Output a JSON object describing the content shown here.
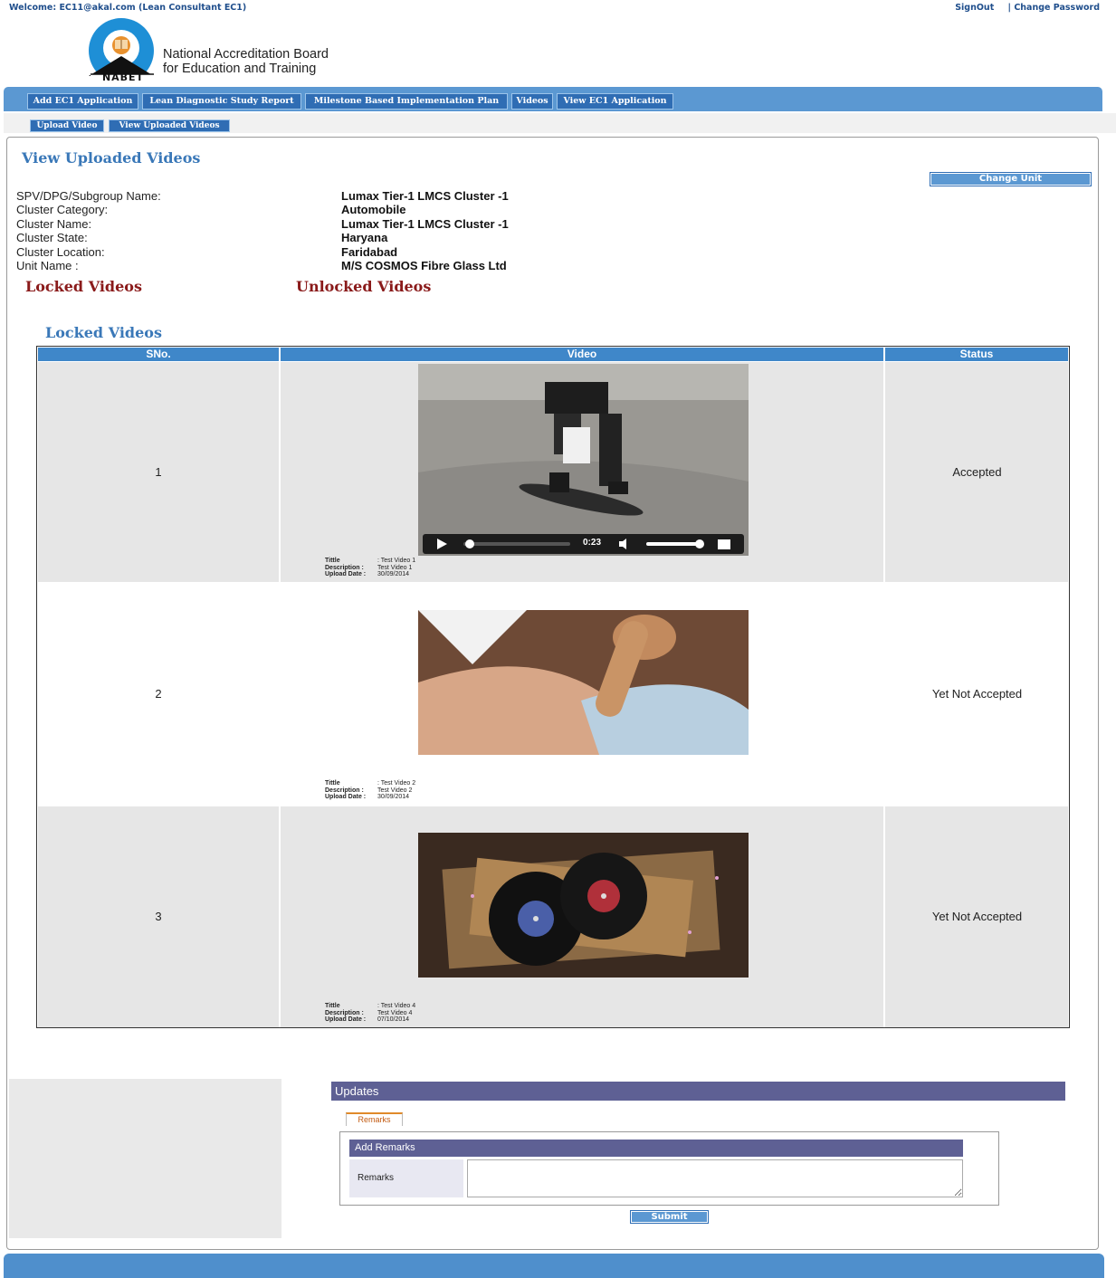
{
  "header": {
    "welcome": "Welcome: EC11@akal.com (Lean Consultant EC1)",
    "signout": "SignOut",
    "change_password": "| Change Password",
    "org_line1": "National Accreditation Board",
    "org_line2": "for Education and Training",
    "logo_text": "NABET"
  },
  "nav": {
    "items": [
      "Add EC1 Application",
      "Lean Diagnostic Study Report",
      "Milestone Based Implementation Plan",
      "Videos",
      "View EC1 Application"
    ]
  },
  "subnav": {
    "items": [
      "Upload Video",
      "View Uploaded Videos"
    ]
  },
  "page": {
    "title": "View Uploaded Videos",
    "change_unit": "Change Unit"
  },
  "info": {
    "rows": [
      {
        "label": "SPV/DPG/Subgroup Name:",
        "value": "Lumax Tier-1 LMCS Cluster -1"
      },
      {
        "label": "Cluster Category:",
        "value": "Automobile"
      },
      {
        "label": "Cluster Name:",
        "value": "Lumax Tier-1 LMCS Cluster -1"
      },
      {
        "label": "Cluster State:",
        "value": "Haryana"
      },
      {
        "label": "Cluster Location:",
        "value": "Faridabad"
      },
      {
        "label": "Unit Name :",
        "value": "M/S COSMOS Fibre Glass Ltd"
      }
    ]
  },
  "tabs": {
    "locked": "Locked Videos",
    "unlocked": "Unlocked Videos"
  },
  "locked_section": {
    "title": "Locked Videos",
    "columns": [
      "SNo.",
      "Video",
      "Status"
    ],
    "rows": [
      {
        "sno": "1",
        "status": "Accepted",
        "title_label": "Tittle",
        "title_value": ":   Test Video 1",
        "desc_label": "Description :",
        "desc_value": "Test Video 1",
        "date_label": "Upload Date :",
        "date_value": "30/09/2014",
        "player_time": "0:23"
      },
      {
        "sno": "2",
        "status": "Yet Not Accepted",
        "title_label": "Tittle",
        "title_value": ":   Test Video 2",
        "desc_label": "Description :",
        "desc_value": "Test Video 2",
        "date_label": "Upload Date :",
        "date_value": "30/09/2014"
      },
      {
        "sno": "3",
        "status": "Yet Not Accepted",
        "title_label": "Tittle",
        "title_value": ":   Test Video 4",
        "desc_label": "Description :",
        "desc_value": "Test Video 4",
        "date_label": "Upload Date :",
        "date_value": "07/10/2014"
      }
    ]
  },
  "updates": {
    "title": "Updates",
    "tab": "Remarks",
    "add_remarks": "Add Remarks",
    "remarks_label": "Remarks",
    "remarks_value": "",
    "submit": "Submit"
  },
  "colors": {
    "nav_blue": "#5b98d2",
    "button_blue": "#2f6db4",
    "heading_blue": "#3a78b8",
    "tab_red": "#8a1a1a",
    "updates_purple": "#5e6094"
  }
}
